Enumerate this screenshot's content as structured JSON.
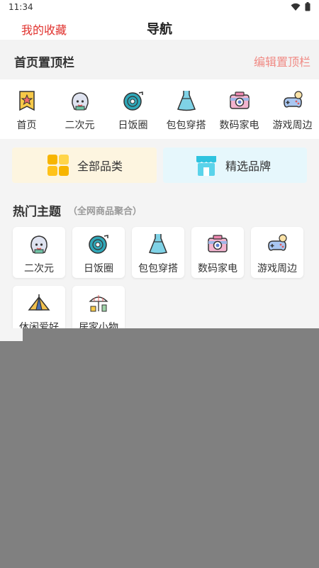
{
  "status_bar": {
    "time": "11:34",
    "icons": [
      "wifi-icon",
      "battery-icon"
    ]
  },
  "header": {
    "left_link": "我的收藏",
    "title": "导航"
  },
  "top_section": {
    "label": "首页置顶栏",
    "edit": "编辑置顶栏"
  },
  "pinned": [
    {
      "label": "首页",
      "icon": "home-star-icon"
    },
    {
      "label": "二次元",
      "icon": "anime-character-icon"
    },
    {
      "label": "日饭圈",
      "icon": "vinyl-record-icon"
    },
    {
      "label": "包包穿搭",
      "icon": "dress-icon"
    },
    {
      "label": "数码家电",
      "icon": "camera-icon"
    },
    {
      "label": "游戏周边",
      "icon": "gamepad-icon"
    }
  ],
  "cards": {
    "all": "全部品类",
    "brand": "精选品牌"
  },
  "hot": {
    "title": "热门主题",
    "subtitle": "（全网商品聚合）",
    "items": [
      {
        "label": "二次元",
        "icon": "anime-character-icon"
      },
      {
        "label": "日饭圈",
        "icon": "vinyl-record-icon"
      },
      {
        "label": "包包穿搭",
        "icon": "dress-icon"
      },
      {
        "label": "数码家电",
        "icon": "camera-icon"
      },
      {
        "label": "游戏周边",
        "icon": "gamepad-icon"
      },
      {
        "label": "休闲爱好",
        "icon": "tent-icon"
      },
      {
        "label": "居家小物",
        "icon": "home-goods-icon"
      }
    ]
  },
  "colors": {
    "accent_red": "#e0312d",
    "edit_pink": "#f08a84",
    "overlay_gray": "#808080"
  }
}
